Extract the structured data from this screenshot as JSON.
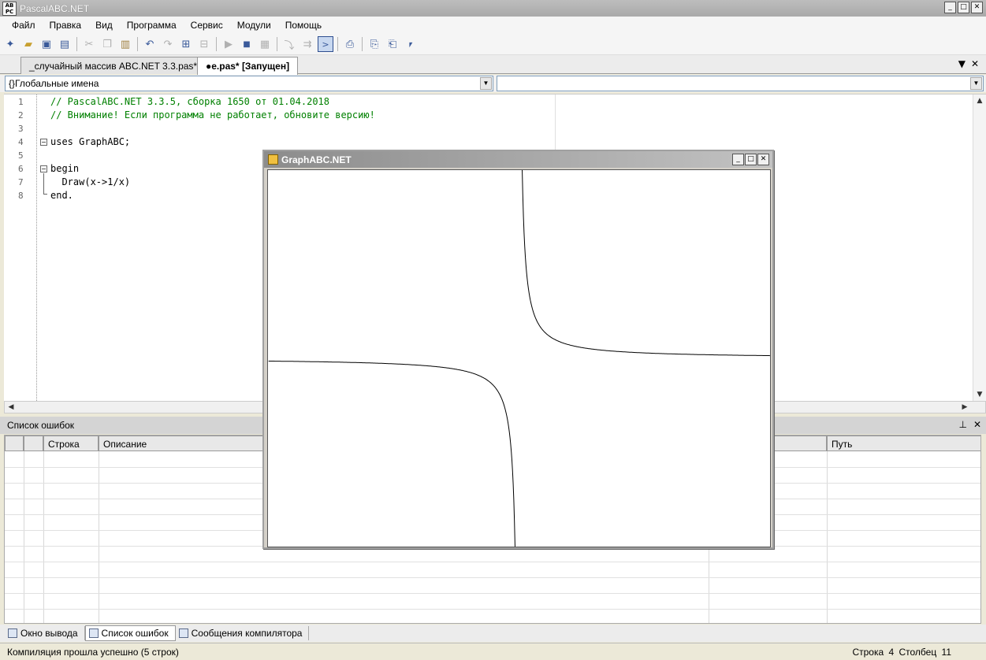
{
  "window": {
    "title": "PascalABC.NET",
    "icon_text": "AB PC",
    "controls": [
      "_",
      "□",
      "✕"
    ]
  },
  "menu": [
    "Файл",
    "Правка",
    "Вид",
    "Программа",
    "Сервис",
    "Модули",
    "Помощь"
  ],
  "toolbar_icons": [
    "new-file-icon",
    "open-folder-icon",
    "save-icon",
    "save-all-icon",
    "cut-icon",
    "copy-icon",
    "paste-icon",
    "undo-icon",
    "redo-icon",
    "find-icon",
    "replace-icon",
    "run-icon",
    "stop-icon",
    "compile-icon",
    "step-icon",
    "step-over-icon",
    "console-window-icon",
    "debug-icon",
    "format-code-icon",
    "step-into-icon",
    "step-out-icon"
  ],
  "tabs": [
    {
      "label": "_случайный массив ABC.NET 3.3.pas*",
      "active": false
    },
    {
      "label": "●e.pas* [Запущен]",
      "active": true
    }
  ],
  "tab_controls": [
    "▼",
    "✕"
  ],
  "combos": {
    "left": "{}Глобальные имена",
    "right": ""
  },
  "code_lines": [
    {
      "n": "1",
      "text": "// PascalABC.NET 3.3.5, сборка 1650 от 01.04.2018",
      "comment": true
    },
    {
      "n": "2",
      "text": "// Внимание! Если программа не работает, обновите версию!",
      "comment": true
    },
    {
      "n": "3",
      "text": "",
      "comment": false
    },
    {
      "n": "4",
      "text": "uses GraphABC;",
      "comment": false
    },
    {
      "n": "5",
      "text": "",
      "comment": false
    },
    {
      "n": "6",
      "text": "begin",
      "comment": false
    },
    {
      "n": "7",
      "text": "  Draw(x->1/x)",
      "comment": false
    },
    {
      "n": "8",
      "text": "end.",
      "comment": false
    }
  ],
  "error_panel": {
    "title": "Список ошибок",
    "controls": [
      "⊥",
      "✕"
    ],
    "columns": [
      "",
      "",
      "Строка",
      "Описание",
      "",
      "Путь"
    ]
  },
  "bottom_tabs": [
    {
      "label": "Окно вывода",
      "selected": false
    },
    {
      "label": "Список ошибок",
      "selected": true
    },
    {
      "label": "Сообщения компилятора",
      "selected": false
    }
  ],
  "status": {
    "message": "Компиляция прошла успешно (5 строк)",
    "position": "Строка  4 Столбец  11"
  },
  "graph_window": {
    "title": "GraphABC.NET",
    "controls": [
      "_",
      "□",
      "✕"
    ],
    "function": "1/x"
  }
}
